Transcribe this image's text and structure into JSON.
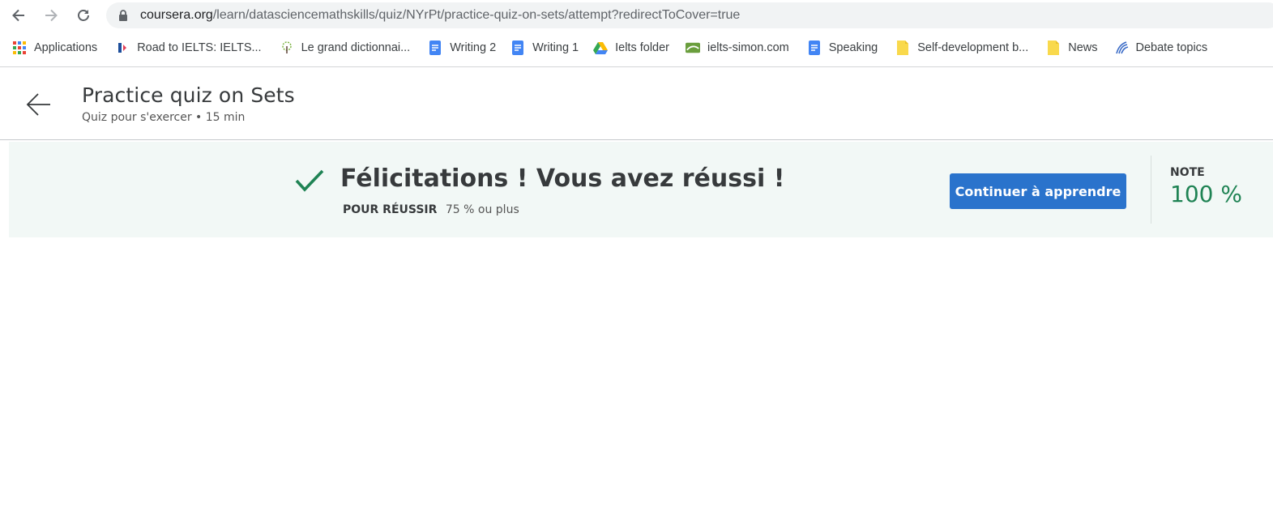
{
  "browser": {
    "url_host": "coursera.org",
    "url_path": "/learn/datasciencemathskills/quiz/NYrPt/practice-quiz-on-sets/attempt?redirectToCover=true",
    "nav_icons": [
      "back-arrow-icon",
      "forward-arrow-icon",
      "reload-icon",
      "lock-icon"
    ]
  },
  "bookmarks": [
    {
      "label": "Applications",
      "icon": "apps-grid-icon"
    },
    {
      "label": "Road to IELTS: IELTS...",
      "icon": "road-to-ielts-icon"
    },
    {
      "label": "Le grand dictionnai...",
      "icon": "dictionary-tree-icon"
    },
    {
      "label": "Writing 2",
      "icon": "google-docs-icon"
    },
    {
      "label": "Writing 1",
      "icon": "google-docs-icon"
    },
    {
      "label": "Ielts folder",
      "icon": "google-drive-icon"
    },
    {
      "label": "ielts-simon.com",
      "icon": "ielts-simon-icon"
    },
    {
      "label": "Speaking",
      "icon": "google-docs-icon"
    },
    {
      "label": "Self-development b...",
      "icon": "folder-note-icon"
    },
    {
      "label": "News",
      "icon": "folder-note-icon"
    },
    {
      "label": "Debate topics",
      "icon": "debate-icon"
    }
  ],
  "header": {
    "title": "Practice quiz on Sets",
    "meta": "Quiz pour s'exercer • 15  min"
  },
  "result": {
    "heading": "Félicitations ! Vous avez réussi !",
    "pass_label": "POUR RÉUSSIR",
    "pass_value": "75 % ou plus",
    "continue_label": "Continuer à apprendre",
    "grade_label": "NOTE",
    "grade_value": "100 %"
  },
  "colors": {
    "primary_button": "#2a73cc",
    "success_green": "#1f8354",
    "banner_bg": "#f2f8f6"
  }
}
